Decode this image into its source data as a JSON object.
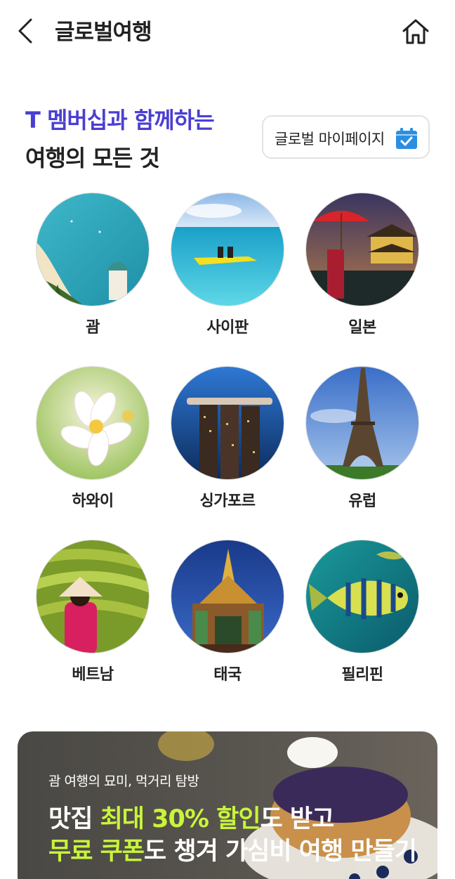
{
  "header": {
    "title": "글로벌여행",
    "back_icon": "chevron-left-icon",
    "home_icon": "home-icon"
  },
  "hero": {
    "line1": "T 멤버십과 함께하는",
    "line2": "여행의 모든 것",
    "accent_color": "#4a3fd1"
  },
  "mypage_button": {
    "label": "글로벌 마이페이지",
    "icon": "calendar-check-icon",
    "icon_color": "#2b8fe0"
  },
  "destinations": [
    {
      "name": "괌"
    },
    {
      "name": "사이판"
    },
    {
      "name": "일본"
    },
    {
      "name": "하와이"
    },
    {
      "name": "싱가포르"
    },
    {
      "name": "유럽"
    },
    {
      "name": "베트남"
    },
    {
      "name": "태국"
    },
    {
      "name": "필리핀"
    }
  ],
  "banner": {
    "subtitle": "괌 여행의 묘미, 먹거리 탐방",
    "line1_a": "맛집 ",
    "line1_highlight": "최대 30% 할인",
    "line1_b": "도 받고",
    "line2_highlight": "무료 쿠폰",
    "line2_b": "도 챙겨 가심비 여행 만들기",
    "highlight_color": "#c8f53a"
  }
}
